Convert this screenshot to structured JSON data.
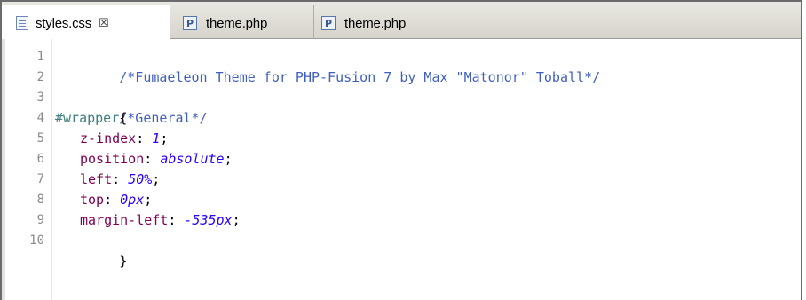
{
  "tabs": [
    {
      "label": "styles.css",
      "close": "☒",
      "icon": "css-file-icon",
      "active": true
    },
    {
      "label": "theme.php",
      "icon": "php-file-icon",
      "active": false
    },
    {
      "label": "theme.php",
      "icon": "php-file-icon",
      "active": false
    }
  ],
  "php_icon_glyph": "P",
  "editor": {
    "line_numbers": [
      "1",
      "2",
      "3",
      "4",
      "5",
      "6",
      "7",
      "8",
      "9",
      "10"
    ],
    "lines": {
      "l1_comment": "/*Fumaeleon Theme for PHP-Fusion 7 by Max \"Matonor\" Toball*/",
      "l3_comment": "/*General*/",
      "l4_selector": "#wrapper",
      "l4_brace": "{",
      "l5_prop": "z-index",
      "l5_colon": ": ",
      "l5_val": "1",
      "l5_semi": ";",
      "l6_prop": "position",
      "l6_colon": ": ",
      "l6_val": "absolute",
      "l6_semi": ";",
      "l7_prop": "left",
      "l7_colon": ": ",
      "l7_val": "50%",
      "l7_semi": ";",
      "l8_prop": "top",
      "l8_colon": ": ",
      "l8_val": "0px",
      "l8_semi": ";",
      "l9_prop": "margin-left",
      "l9_colon": ": ",
      "l9_val": "-535px",
      "l9_semi": ";",
      "l10_brace": "}"
    }
  },
  "colors": {
    "comment": "#3f5fbf",
    "selector": "#3f7f7f",
    "property": "#7f0055",
    "value": "#2a00ff"
  }
}
